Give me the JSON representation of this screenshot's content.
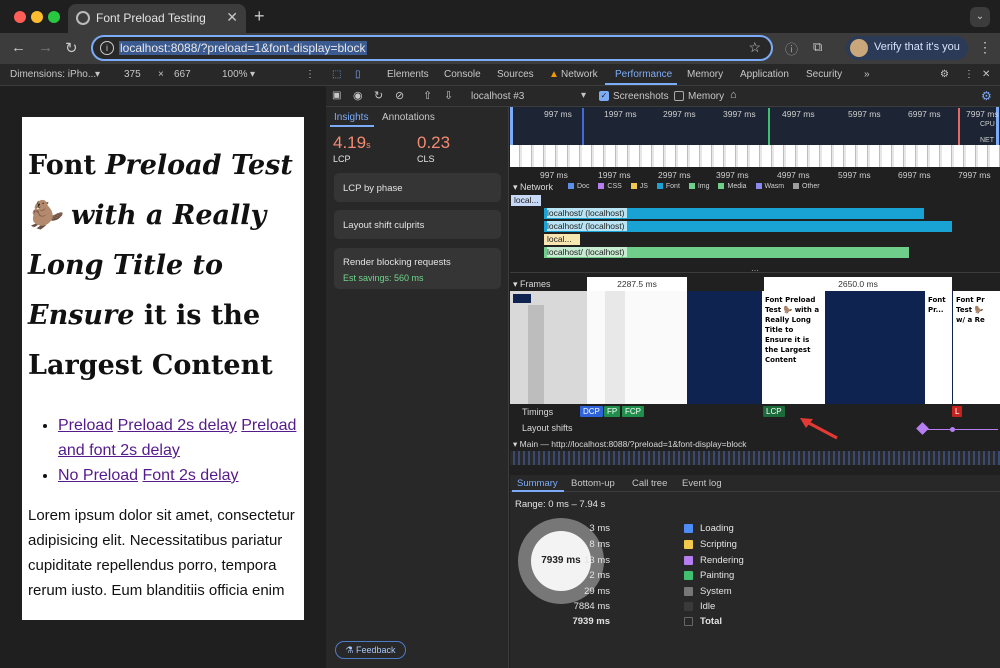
{
  "browser": {
    "tab_title": "Font Preload Testing",
    "url": "localhost:8088/?preload=1&font-display=block",
    "verify_label": "Verify that it's you"
  },
  "device_toolbar": {
    "dimensions_label": "Dimensions: iPho...",
    "width": "375",
    "times": "×",
    "height": "667",
    "zoom": "100%"
  },
  "devtools_tabs": [
    "Elements",
    "Console",
    "Sources",
    "Network",
    "Performance",
    "Memory",
    "Application",
    "Security",
    "»"
  ],
  "perf_toolbar": {
    "profile": "localhost #3",
    "screenshots_label": "Screenshots",
    "memory_label": "Memory"
  },
  "sidebar": {
    "tabs": [
      "Insights",
      "Annotations"
    ],
    "lcp_value": "4.19",
    "lcp_unit": "s",
    "lcp_label": "LCP",
    "cls_value": "0.23",
    "cls_label": "CLS",
    "cards": {
      "lcp_by_phase": "LCP by phase",
      "layout_shift": "Layout shift culprits",
      "render_blocking": "Render blocking requests",
      "savings": "Est savings: 560 ms"
    },
    "feedback": "Feedback"
  },
  "page": {
    "title_parts": [
      "Font ",
      "Preload Test",
      "🦫 with a Really Long Title to Ensure",
      " it is the Largest Content"
    ],
    "links_row1": [
      "Preload",
      "Preload 2s delay",
      "Preload and font 2s delay"
    ],
    "links_row2": [
      "No Preload",
      "Font 2s delay"
    ],
    "paragraph": "Lorem ipsum dolor sit amet, consectetur adipisicing elit. Necessitatibus pariatur cupiditate repellendus porro, tempora rerum iusto. Eum blanditiis officia enim"
  },
  "timeline": {
    "overview_ticks": [
      "997 ms",
      "1997 ms",
      "2997 ms",
      "3997 ms",
      "4997 ms",
      "5997 ms",
      "6997 ms",
      "7997 ms"
    ],
    "cpu_label": "CPU",
    "net_label": "NET",
    "ruler_ticks": [
      "997 ms",
      "1997 ms",
      "2997 ms",
      "3997 ms",
      "4997 ms",
      "5997 ms",
      "6997 ms",
      "7997 ms"
    ],
    "network_label": "Network",
    "legend": [
      {
        "name": "Doc",
        "color": "#5b8fe8"
      },
      {
        "name": "CSS",
        "color": "#b77ef2"
      },
      {
        "name": "JS",
        "color": "#f3c94c"
      },
      {
        "name": "Font",
        "color": "#19a2d4"
      },
      {
        "name": "Img",
        "color": "#6fcf8a"
      },
      {
        "name": "Media",
        "color": "#6fcf8a"
      },
      {
        "name": "Wasm",
        "color": "#8a8af0"
      },
      {
        "name": "Other",
        "color": "#9e9e9e"
      }
    ],
    "requests": [
      "local...",
      "localhost/ (localhost)",
      "localhost/ (localhost)",
      "local...",
      "localhost/ (localhost)"
    ],
    "frames_label": "Frames",
    "frame_durations": [
      "2287.5 ms",
      "2650.0 ms"
    ],
    "frame_title_a": "Font Preload Test 🦫 with a Really Long Title to Ensure it is the Largest Content",
    "timings_label": "Timings",
    "timings": [
      "DCP",
      "FP",
      "FCP",
      "LCP",
      "L"
    ],
    "layout_shifts_label": "Layout shifts",
    "main_label": "Main — http://localhost:8088/?preload=1&font-display=block"
  },
  "summary": {
    "tabs": [
      "Summary",
      "Bottom-up",
      "Call tree",
      "Event log"
    ],
    "range": "Range: 0 ms – 7.94 s",
    "donut_label": "7939 ms",
    "rows": [
      {
        "value": "3 ms",
        "name": "Loading",
        "color": "#4e8cf7"
      },
      {
        "value": "8 ms",
        "name": "Scripting",
        "color": "#f3c94c"
      },
      {
        "value": "13 ms",
        "name": "Rendering",
        "color": "#b77ef2"
      },
      {
        "value": "2 ms",
        "name": "Painting",
        "color": "#3fbf6f"
      },
      {
        "value": "29 ms",
        "name": "System",
        "color": "#777777"
      },
      {
        "value": "7884 ms",
        "name": "Idle",
        "color": "#3a3a3a"
      },
      {
        "value": "7939 ms",
        "name": "Total",
        "color": "#282828"
      }
    ]
  }
}
